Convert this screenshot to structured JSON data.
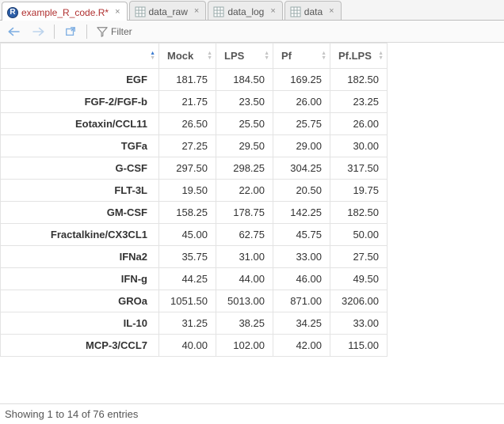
{
  "tabs": [
    {
      "label": "example_R_code.R*",
      "kind": "r",
      "active": true
    },
    {
      "label": "data_raw",
      "kind": "grid",
      "active": false
    },
    {
      "label": "data_log",
      "kind": "grid",
      "active": false
    },
    {
      "label": "data",
      "kind": "grid",
      "active": false
    }
  ],
  "toolbar": {
    "filter_label": "Filter"
  },
  "table": {
    "columns": [
      "",
      "Mock",
      "LPS",
      "Pf",
      "Pf.LPS"
    ],
    "rows": [
      {
        "label": "EGF",
        "vals": [
          "181.75",
          "184.50",
          "169.25",
          "182.50"
        ]
      },
      {
        "label": "FGF-2/FGF-b",
        "vals": [
          "21.75",
          "23.50",
          "26.00",
          "23.25"
        ]
      },
      {
        "label": "Eotaxin/CCL11",
        "vals": [
          "26.50",
          "25.50",
          "25.75",
          "26.00"
        ]
      },
      {
        "label": "TGFa",
        "vals": [
          "27.25",
          "29.50",
          "29.00",
          "30.00"
        ]
      },
      {
        "label": "G-CSF",
        "vals": [
          "297.50",
          "298.25",
          "304.25",
          "317.50"
        ]
      },
      {
        "label": "FLT-3L",
        "vals": [
          "19.50",
          "22.00",
          "20.50",
          "19.75"
        ]
      },
      {
        "label": "GM-CSF",
        "vals": [
          "158.25",
          "178.75",
          "142.25",
          "182.50"
        ]
      },
      {
        "label": "Fractalkine/CX3CL1",
        "vals": [
          "45.00",
          "62.75",
          "45.75",
          "50.00"
        ]
      },
      {
        "label": "IFNa2",
        "vals": [
          "35.75",
          "31.00",
          "33.00",
          "27.50"
        ]
      },
      {
        "label": "IFN-g",
        "vals": [
          "44.25",
          "44.00",
          "46.00",
          "49.50"
        ]
      },
      {
        "label": "GROa",
        "vals": [
          "1051.50",
          "5013.00",
          "871.00",
          "3206.00"
        ]
      },
      {
        "label": "IL-10",
        "vals": [
          "31.25",
          "38.25",
          "34.25",
          "33.00"
        ]
      },
      {
        "label": "MCP-3/CCL7",
        "vals": [
          "40.00",
          "102.00",
          "42.00",
          "115.00"
        ]
      }
    ]
  },
  "status": "Showing 1 to 14 of 76 entries"
}
